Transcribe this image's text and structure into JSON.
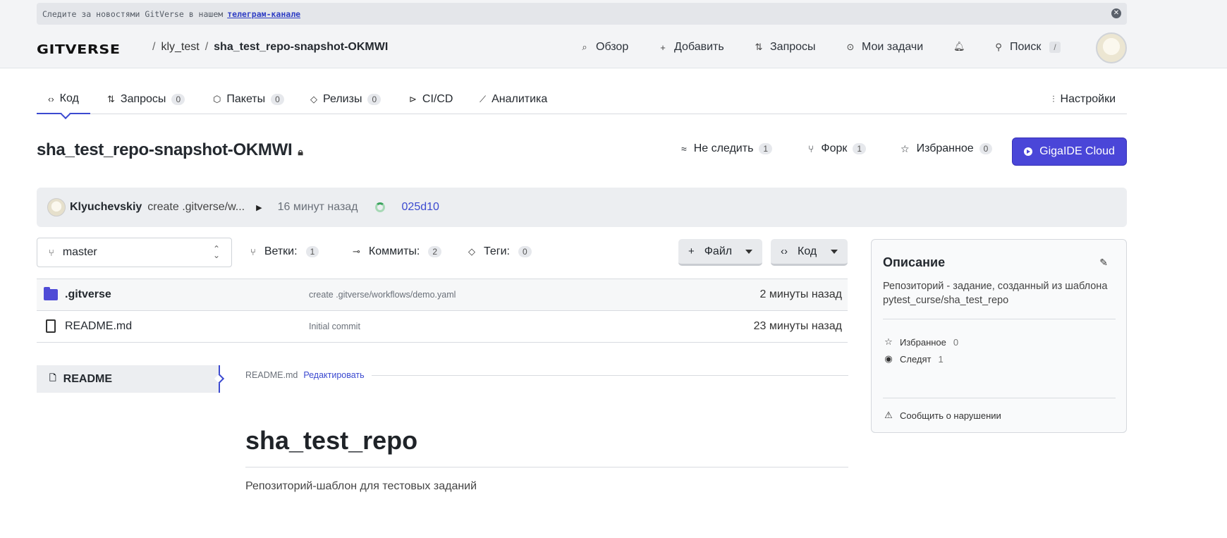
{
  "banner": {
    "text": "Следите за новостями GitVerse в нашем",
    "link": "телеграм-канале",
    "close_icon": "close-icon"
  },
  "header": {
    "logo": "GITVERSE",
    "breadcrumb": {
      "owner": "kly_test",
      "repo": "sha_test_repo-snapshot-OKMWI"
    },
    "nav": [
      {
        "label": "Обзор",
        "icon": "explore-icon"
      },
      {
        "label": "Добавить",
        "icon": "plus-icon"
      },
      {
        "label": "Запросы",
        "icon": "pull-request-icon"
      },
      {
        "label": "Мои задачи",
        "icon": "issues-icon"
      }
    ],
    "bell_icon": "bell-icon",
    "search": {
      "label": "Поиск",
      "shortcut": "/"
    }
  },
  "tabs": [
    {
      "label": "Код",
      "count": null,
      "active": true
    },
    {
      "label": "Запросы",
      "count": "0"
    },
    {
      "label": "Пакеты",
      "count": "0"
    },
    {
      "label": "Релизы",
      "count": "0"
    },
    {
      "label": "CI/CD",
      "count": null
    },
    {
      "label": "Аналитика",
      "count": null
    }
  ],
  "settings": {
    "label": "Настройки"
  },
  "repo": {
    "title": "sha_test_repo-snapshot-OKMWI",
    "watch": {
      "label": "Не следить",
      "count": "1"
    },
    "fork": {
      "label": "Форк",
      "count": "1"
    },
    "star": {
      "label": "Избранное",
      "count": "0"
    },
    "ide": {
      "label": "GigaIDE Cloud"
    }
  },
  "commit": {
    "author": "Klyuchevskiy",
    "message": "create .gitverse/w...",
    "time": "16 минут назад",
    "sha": "025d10"
  },
  "branch": {
    "current": "master",
    "branches": {
      "label": "Ветки:",
      "count": "1"
    },
    "commits": {
      "label": "Коммиты:",
      "count": "2"
    },
    "tags": {
      "label": "Теги:",
      "count": "0"
    },
    "file_button": "Файл",
    "code_button": "Код"
  },
  "files": [
    {
      "name": ".gitverse",
      "type": "folder",
      "message": "create .gitverse/workflows/demo.yaml",
      "time": "2 минуты назад"
    },
    {
      "name": "README.md",
      "type": "file",
      "message": "Initial commit",
      "time": "23 минуты назад"
    }
  ],
  "readme": {
    "tab": "README",
    "filename": "README.md",
    "edit": "Редактировать",
    "heading": "sha_test_repo",
    "paragraph": "Репозиторий-шаблон для тестовых заданий"
  },
  "sidebar": {
    "title": "Описание",
    "description": "Репозиторий - задание, созданный из шаблона pytest_curse/sha_test_repo",
    "favorites": {
      "label": "Избранное",
      "count": "0"
    },
    "watchers": {
      "label": "Следят",
      "count": "1"
    },
    "report": "Сообщить о нарушении"
  }
}
